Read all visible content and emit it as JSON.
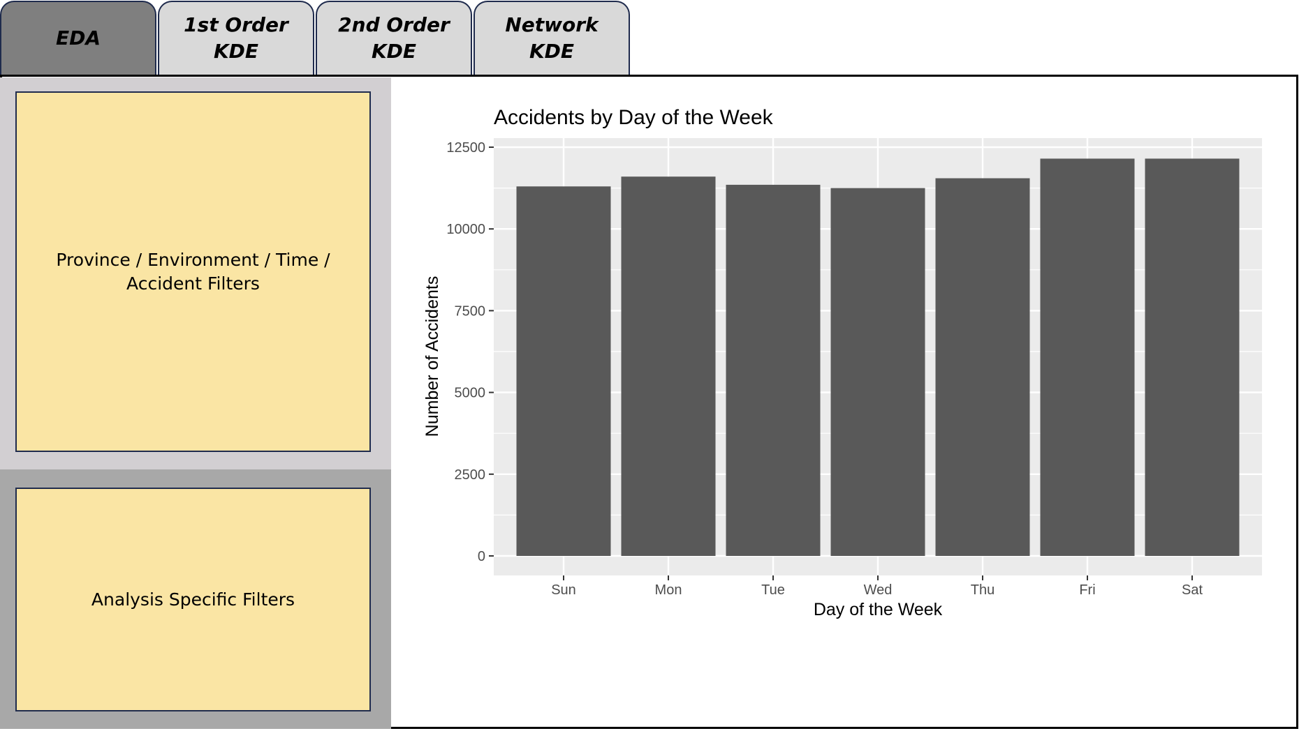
{
  "tabs": [
    {
      "label": "EDA",
      "active": true
    },
    {
      "label": "1st Order\nKDE",
      "active": false
    },
    {
      "label": "2nd Order\nKDE",
      "active": false
    },
    {
      "label": "Network\nKDE",
      "active": false
    }
  ],
  "sidebar": {
    "filters_label": "Province / Environment / Time / Accident Filters",
    "analysis_label": "Analysis Specific Filters"
  },
  "colors": {
    "active_tab": "#7f7f7f",
    "inactive_tab": "#d9d9d9",
    "filter_box": "#fae5a4",
    "bar": "#595959",
    "plot_panel": "#ebebeb"
  },
  "chart_data": {
    "type": "bar",
    "title": "Accidents by Day of the Week",
    "xlabel": "Day of the Week",
    "ylabel": "Number of Accidents",
    "categories": [
      "Sun",
      "Mon",
      "Tue",
      "Wed",
      "Thu",
      "Fri",
      "Sat"
    ],
    "values": [
      11300,
      11600,
      11350,
      11250,
      11550,
      12150,
      12150
    ],
    "ylim": [
      0,
      12500
    ],
    "yticks": [
      0,
      2500,
      5000,
      7500,
      10000,
      12500
    ],
    "grid": true,
    "legend": "none"
  }
}
